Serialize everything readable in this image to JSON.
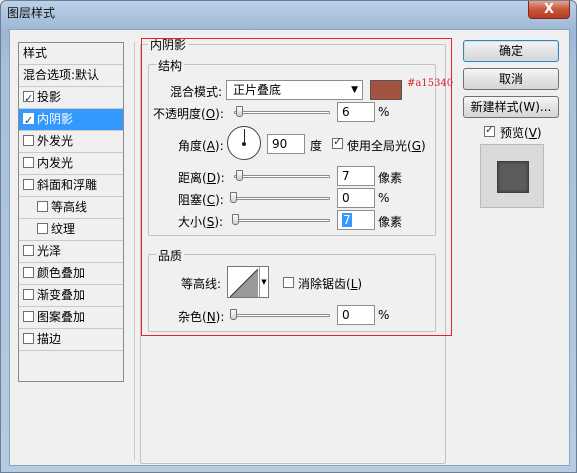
{
  "window": {
    "title": "图层样式",
    "close_label": "X"
  },
  "styles_list": {
    "header": "样式",
    "blend_options": "混合选项:默认",
    "items": [
      {
        "label": "投影",
        "checked": true,
        "selected": false,
        "indent": false
      },
      {
        "label": "内阴影",
        "checked": true,
        "selected": true,
        "indent": false
      },
      {
        "label": "外发光",
        "checked": false,
        "selected": false,
        "indent": false
      },
      {
        "label": "内发光",
        "checked": false,
        "selected": false,
        "indent": false
      },
      {
        "label": "斜面和浮雕",
        "checked": false,
        "selected": false,
        "indent": false
      },
      {
        "label": "等高线",
        "checked": false,
        "selected": false,
        "indent": true
      },
      {
        "label": "纹理",
        "checked": false,
        "selected": false,
        "indent": true
      },
      {
        "label": "光泽",
        "checked": false,
        "selected": false,
        "indent": false
      },
      {
        "label": "颜色叠加",
        "checked": false,
        "selected": false,
        "indent": false
      },
      {
        "label": "渐变叠加",
        "checked": false,
        "selected": false,
        "indent": false
      },
      {
        "label": "图案叠加",
        "checked": false,
        "selected": false,
        "indent": false
      },
      {
        "label": "描边",
        "checked": false,
        "selected": false,
        "indent": false
      }
    ]
  },
  "inner_shadow": {
    "title": "内阴影",
    "structure": {
      "title": "结构",
      "blend_mode_label": "混合模式:",
      "blend_mode_value": "正片叠底",
      "color_hex": "#a15340",
      "color_annotation": "#a15340",
      "opacity_label": "不透明度(O):",
      "opacity_value": "6",
      "opacity_unit": "%",
      "angle_label": "角度(A):",
      "angle_value": "90",
      "angle_unit": "度",
      "global_light_label": "使用全局光(G)",
      "global_light_checked": true,
      "distance_label": "距离(D):",
      "distance_value": "7",
      "distance_unit": "像素",
      "choke_label": "阻塞(C):",
      "choke_value": "0",
      "choke_unit": "%",
      "size_label": "大小(S):",
      "size_value": "7",
      "size_unit": "像素"
    },
    "quality": {
      "title": "品质",
      "contour_label": "等高线:",
      "antialias_label": "消除锯齿(L)",
      "antialias_checked": false,
      "noise_label": "杂色(N):",
      "noise_value": "0",
      "noise_unit": "%"
    }
  },
  "buttons": {
    "ok": "确定",
    "cancel": "取消",
    "new_style": "新建样式(W)...",
    "preview_label": "预览(V)",
    "preview_checked": true
  }
}
